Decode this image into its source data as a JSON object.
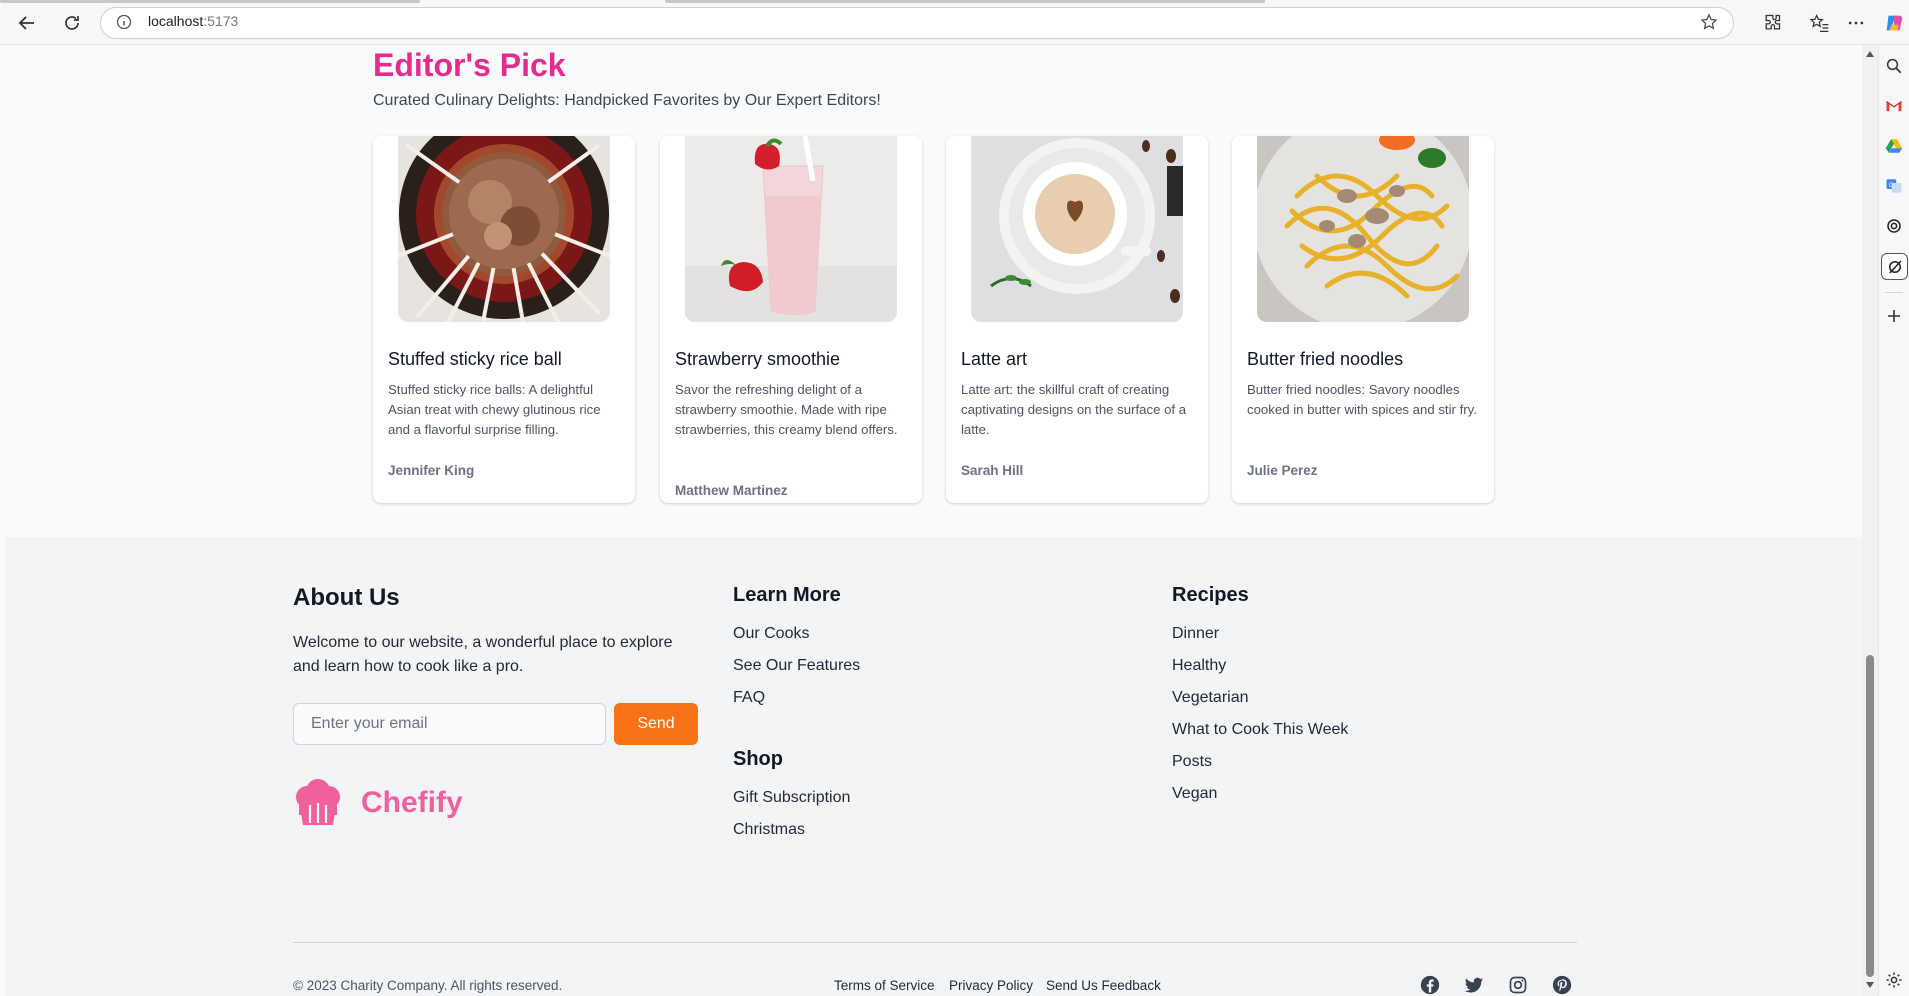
{
  "browser": {
    "url_host": "localhost",
    "url_port": ":5173"
  },
  "picks": {
    "title": "Editor's Pick",
    "subtitle": "Curated Culinary Delights: Handpicked Favorites by Our Expert Editors!",
    "cards": [
      {
        "title": "Stuffed sticky rice ball",
        "desc": "Stuffed sticky rice balls: A delightful Asian treat with chewy glutinous rice and a flavorful surprise filling.",
        "author": "Jennifer King"
      },
      {
        "title": "Strawberry smoothie",
        "desc": "Savor the refreshing delight of a strawberry smoothie. Made with ripe strawberries, this creamy blend offers.",
        "author": "Matthew Martinez"
      },
      {
        "title": "Latte art",
        "desc": "Latte art: the skillful craft of creating captivating designs on the surface of a latte.",
        "author": "Sarah Hill"
      },
      {
        "title": "Butter fried noodles",
        "desc": "Butter fried noodles: Savory noodles cooked in butter with spices and stir fry.",
        "author": "Julie Perez"
      }
    ]
  },
  "footer": {
    "about_title": "About Us",
    "about_text": "Welcome to our website, a wonderful place to explore and learn how to cook like a pro.",
    "email_placeholder": "Enter your email",
    "send_label": "Send",
    "brand": "Chefify",
    "learn_title": "Learn More",
    "learn_links": [
      "Our Cooks",
      "See Our Features",
      "FAQ"
    ],
    "shop_title": "Shop",
    "shop_links": [
      "Gift Subscription",
      "Christmas"
    ],
    "recipes_title": "Recipes",
    "recipes_links": [
      "Dinner",
      "Healthy",
      "Vegetarian",
      "What to Cook This Week",
      "Posts",
      "Vegan"
    ],
    "copyright": "© 2023 Charity Company. All rights reserved.",
    "legal": [
      "Terms of Service",
      "Privacy Policy",
      "Send Us Feedback"
    ],
    "social": [
      "facebook-icon",
      "twitter-icon",
      "instagram-icon",
      "pinterest-icon"
    ]
  },
  "colors": {
    "accent_pink": "#e72a8e",
    "brand_pink": "#f0609c",
    "send_orange": "#f97316"
  }
}
